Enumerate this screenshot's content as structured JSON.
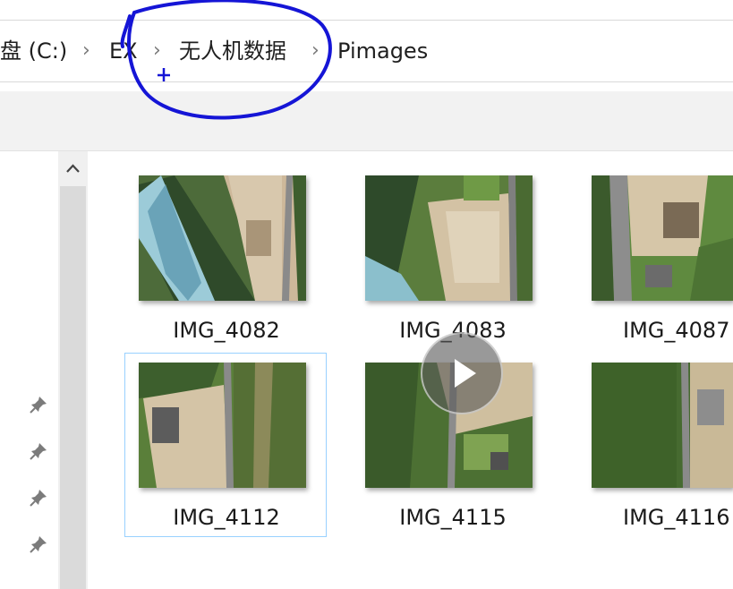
{
  "breadcrumb": {
    "segments": [
      "盘 (C:)",
      "EX",
      "无人机数据",
      "Pimages"
    ]
  },
  "files": [
    {
      "name": "IMG_4082",
      "selected": false
    },
    {
      "name": "IMG_4083",
      "selected": false
    },
    {
      "name": "IMG_4087",
      "selected": false
    },
    {
      "name": "IMG_4112",
      "selected": true
    },
    {
      "name": "IMG_4115",
      "selected": false
    },
    {
      "name": "IMG_4116",
      "selected": false
    }
  ],
  "icons": {
    "breadcrumb_separator": "chevron-right-icon",
    "quick_access_pin": "pin-icon",
    "scroll_up": "chevron-up-icon",
    "video_overlay": "play-icon"
  },
  "colors": {
    "annotation_ink": "#1515d6",
    "selection_border": "#99d1ff",
    "toolbar_bg": "#f2f2f2"
  }
}
